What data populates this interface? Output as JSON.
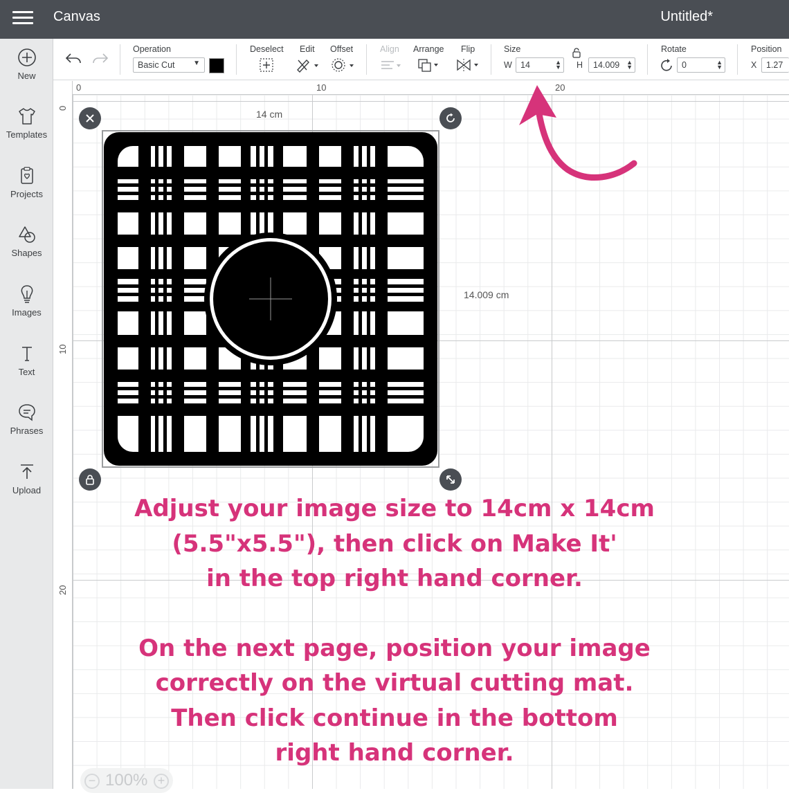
{
  "app": {
    "title": "Canvas",
    "document_title": "Untitled*"
  },
  "sidebar": {
    "items": [
      {
        "label": "New",
        "icon": "plus-circle-icon"
      },
      {
        "label": "Templates",
        "icon": "shirt-icon"
      },
      {
        "label": "Projects",
        "icon": "projects-icon"
      },
      {
        "label": "Shapes",
        "icon": "shapes-icon"
      },
      {
        "label": "Images",
        "icon": "lightbulb-icon"
      },
      {
        "label": "Text",
        "icon": "text-icon"
      },
      {
        "label": "Phrases",
        "icon": "speech-bubble-icon"
      },
      {
        "label": "Upload",
        "icon": "upload-icon"
      }
    ]
  },
  "toolbar": {
    "operation_label": "Operation",
    "operation_value": "Basic Cut",
    "operation_color": "#000000",
    "deselect_label": "Deselect",
    "edit_label": "Edit",
    "offset_label": "Offset",
    "align_label": "Align",
    "arrange_label": "Arrange",
    "flip_label": "Flip",
    "size_label": "Size",
    "size_w_label": "W",
    "size_w_value": "14",
    "size_h_label": "H",
    "size_h_value": "14.009",
    "rotate_label": "Rotate",
    "rotate_value": "0",
    "position_label": "Position",
    "position_x_label": "X",
    "position_x_value": "1.27"
  },
  "rulers": {
    "top": [
      "0",
      "10",
      "20"
    ],
    "left": [
      "0",
      "10",
      "20"
    ]
  },
  "selection": {
    "width_label": "14 cm",
    "height_label": "14.009 cm"
  },
  "instructions": {
    "line1": "Adjust your image size to 14cm x 14cm",
    "line2": "(5.5\"x5.5\"), then click on Make It'",
    "line3": "in the top right hand corner.",
    "line4": "On the next page, position your image",
    "line5": "correctly on the virtual cutting mat.",
    "line6": "Then click continue in the bottom",
    "line7": "right hand corner."
  },
  "zoom": {
    "value": "100%"
  },
  "colors": {
    "accent": "#d6337a",
    "topbar": "#4a4e54"
  }
}
